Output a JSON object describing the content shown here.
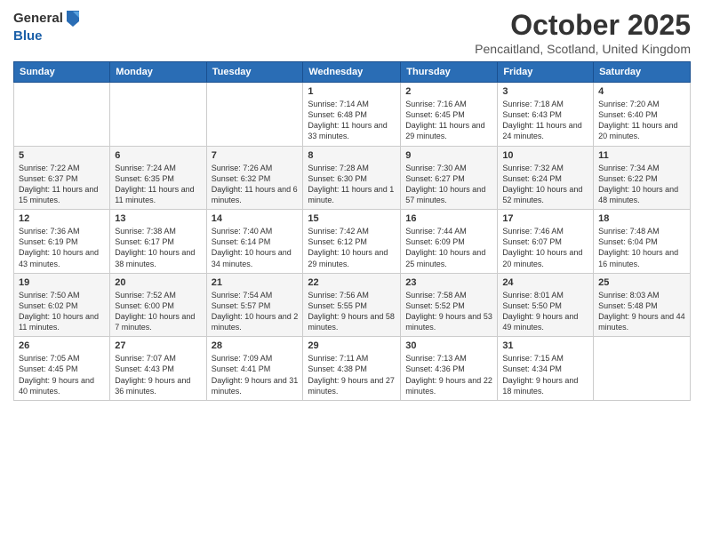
{
  "header": {
    "logo_general": "General",
    "logo_blue": "Blue",
    "month_title": "October 2025",
    "location": "Pencaitland, Scotland, United Kingdom"
  },
  "weekdays": [
    "Sunday",
    "Monday",
    "Tuesday",
    "Wednesday",
    "Thursday",
    "Friday",
    "Saturday"
  ],
  "weeks": [
    [
      {
        "day": "",
        "info": ""
      },
      {
        "day": "",
        "info": ""
      },
      {
        "day": "",
        "info": ""
      },
      {
        "day": "1",
        "info": "Sunrise: 7:14 AM\nSunset: 6:48 PM\nDaylight: 11 hours and 33 minutes."
      },
      {
        "day": "2",
        "info": "Sunrise: 7:16 AM\nSunset: 6:45 PM\nDaylight: 11 hours and 29 minutes."
      },
      {
        "day": "3",
        "info": "Sunrise: 7:18 AM\nSunset: 6:43 PM\nDaylight: 11 hours and 24 minutes."
      },
      {
        "day": "4",
        "info": "Sunrise: 7:20 AM\nSunset: 6:40 PM\nDaylight: 11 hours and 20 minutes."
      }
    ],
    [
      {
        "day": "5",
        "info": "Sunrise: 7:22 AM\nSunset: 6:37 PM\nDaylight: 11 hours and 15 minutes."
      },
      {
        "day": "6",
        "info": "Sunrise: 7:24 AM\nSunset: 6:35 PM\nDaylight: 11 hours and 11 minutes."
      },
      {
        "day": "7",
        "info": "Sunrise: 7:26 AM\nSunset: 6:32 PM\nDaylight: 11 hours and 6 minutes."
      },
      {
        "day": "8",
        "info": "Sunrise: 7:28 AM\nSunset: 6:30 PM\nDaylight: 11 hours and 1 minute."
      },
      {
        "day": "9",
        "info": "Sunrise: 7:30 AM\nSunset: 6:27 PM\nDaylight: 10 hours and 57 minutes."
      },
      {
        "day": "10",
        "info": "Sunrise: 7:32 AM\nSunset: 6:24 PM\nDaylight: 10 hours and 52 minutes."
      },
      {
        "day": "11",
        "info": "Sunrise: 7:34 AM\nSunset: 6:22 PM\nDaylight: 10 hours and 48 minutes."
      }
    ],
    [
      {
        "day": "12",
        "info": "Sunrise: 7:36 AM\nSunset: 6:19 PM\nDaylight: 10 hours and 43 minutes."
      },
      {
        "day": "13",
        "info": "Sunrise: 7:38 AM\nSunset: 6:17 PM\nDaylight: 10 hours and 38 minutes."
      },
      {
        "day": "14",
        "info": "Sunrise: 7:40 AM\nSunset: 6:14 PM\nDaylight: 10 hours and 34 minutes."
      },
      {
        "day": "15",
        "info": "Sunrise: 7:42 AM\nSunset: 6:12 PM\nDaylight: 10 hours and 29 minutes."
      },
      {
        "day": "16",
        "info": "Sunrise: 7:44 AM\nSunset: 6:09 PM\nDaylight: 10 hours and 25 minutes."
      },
      {
        "day": "17",
        "info": "Sunrise: 7:46 AM\nSunset: 6:07 PM\nDaylight: 10 hours and 20 minutes."
      },
      {
        "day": "18",
        "info": "Sunrise: 7:48 AM\nSunset: 6:04 PM\nDaylight: 10 hours and 16 minutes."
      }
    ],
    [
      {
        "day": "19",
        "info": "Sunrise: 7:50 AM\nSunset: 6:02 PM\nDaylight: 10 hours and 11 minutes."
      },
      {
        "day": "20",
        "info": "Sunrise: 7:52 AM\nSunset: 6:00 PM\nDaylight: 10 hours and 7 minutes."
      },
      {
        "day": "21",
        "info": "Sunrise: 7:54 AM\nSunset: 5:57 PM\nDaylight: 10 hours and 2 minutes."
      },
      {
        "day": "22",
        "info": "Sunrise: 7:56 AM\nSunset: 5:55 PM\nDaylight: 9 hours and 58 minutes."
      },
      {
        "day": "23",
        "info": "Sunrise: 7:58 AM\nSunset: 5:52 PM\nDaylight: 9 hours and 53 minutes."
      },
      {
        "day": "24",
        "info": "Sunrise: 8:01 AM\nSunset: 5:50 PM\nDaylight: 9 hours and 49 minutes."
      },
      {
        "day": "25",
        "info": "Sunrise: 8:03 AM\nSunset: 5:48 PM\nDaylight: 9 hours and 44 minutes."
      }
    ],
    [
      {
        "day": "26",
        "info": "Sunrise: 7:05 AM\nSunset: 4:45 PM\nDaylight: 9 hours and 40 minutes."
      },
      {
        "day": "27",
        "info": "Sunrise: 7:07 AM\nSunset: 4:43 PM\nDaylight: 9 hours and 36 minutes."
      },
      {
        "day": "28",
        "info": "Sunrise: 7:09 AM\nSunset: 4:41 PM\nDaylight: 9 hours and 31 minutes."
      },
      {
        "day": "29",
        "info": "Sunrise: 7:11 AM\nSunset: 4:38 PM\nDaylight: 9 hours and 27 minutes."
      },
      {
        "day": "30",
        "info": "Sunrise: 7:13 AM\nSunset: 4:36 PM\nDaylight: 9 hours and 22 minutes."
      },
      {
        "day": "31",
        "info": "Sunrise: 7:15 AM\nSunset: 4:34 PM\nDaylight: 9 hours and 18 minutes."
      },
      {
        "day": "",
        "info": ""
      }
    ]
  ]
}
